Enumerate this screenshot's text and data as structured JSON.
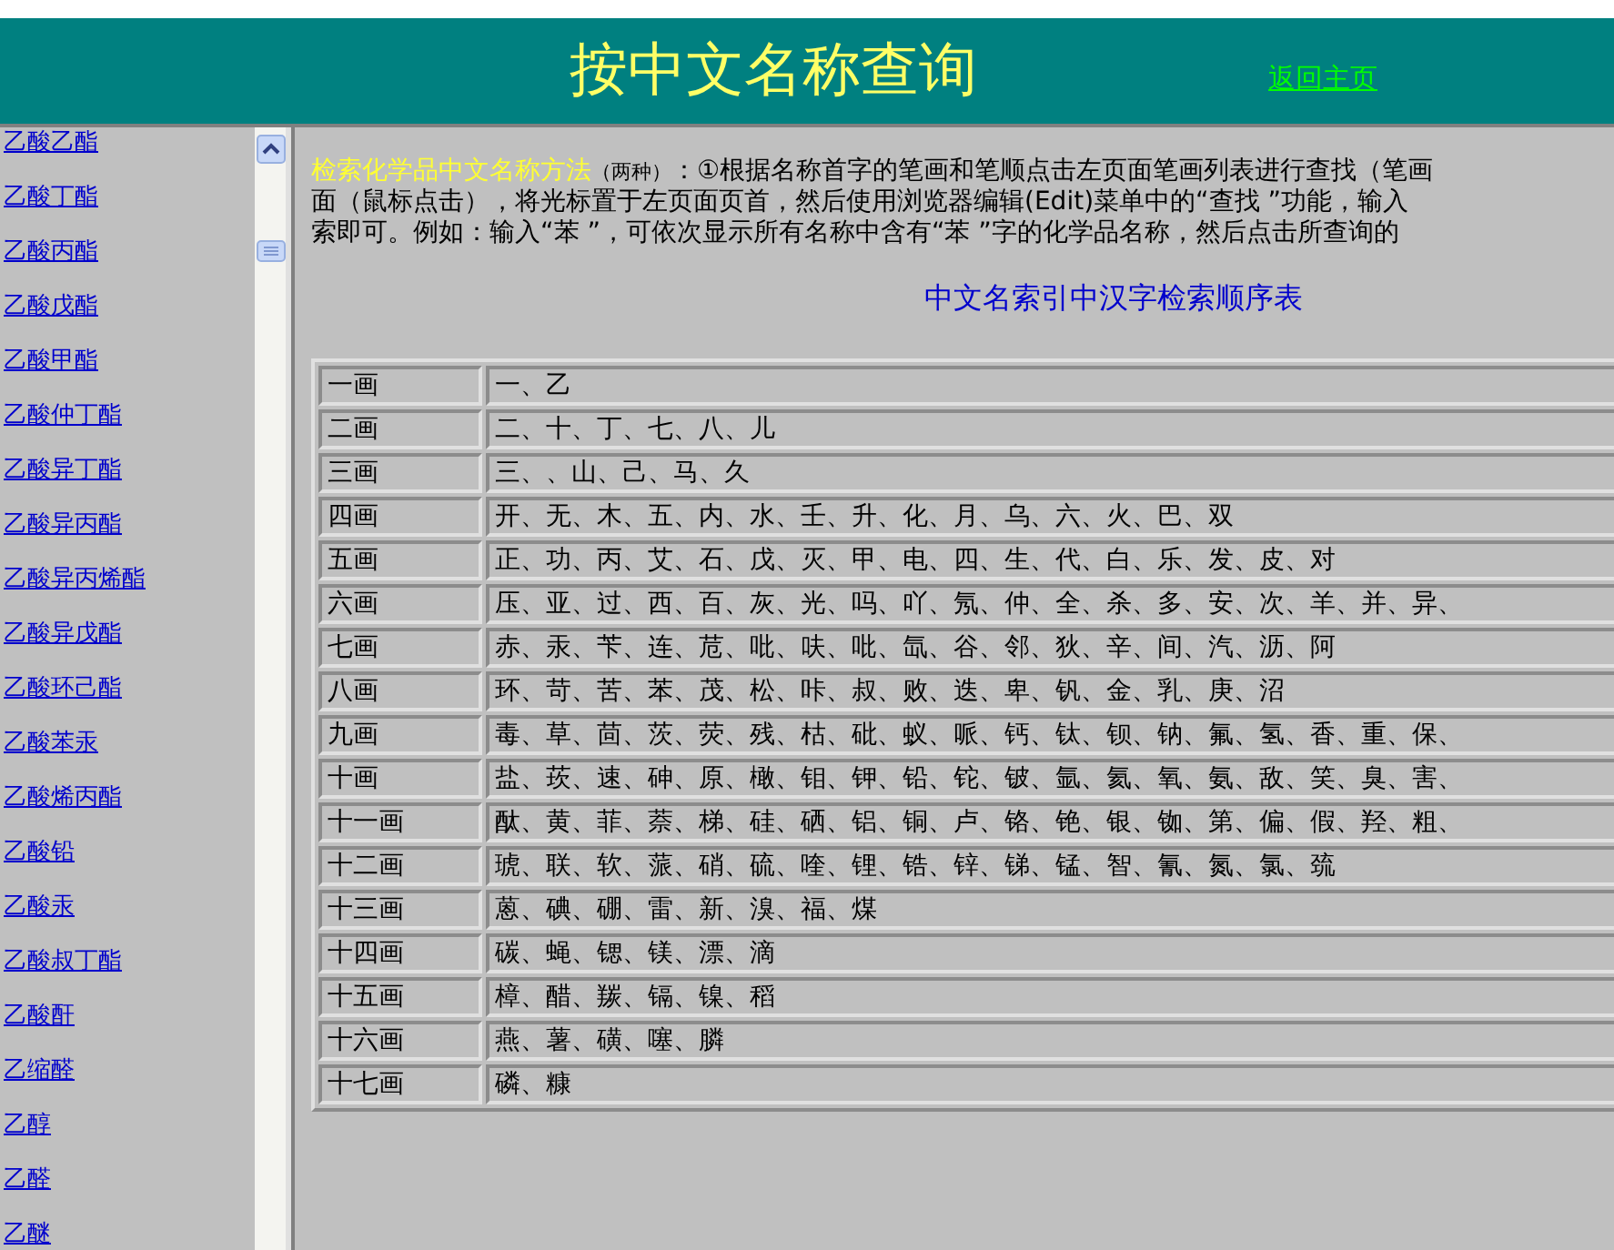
{
  "header": {
    "title": "按中文名称查询",
    "home_link": "返回主页"
  },
  "sidebar": {
    "items": [
      "乙酸乙酯",
      "乙酸丁酯",
      "乙酸丙酯",
      "乙酸戊酯",
      "乙酸甲酯",
      "乙酸仲丁酯",
      "乙酸异丁酯",
      "乙酸异丙酯",
      "乙酸异丙烯酯",
      "乙酸异戊酯",
      "乙酸环己酯",
      "乙酸苯汞",
      "乙酸烯丙酯",
      "乙酸铅",
      "乙酸汞",
      "乙酸叔丁酯",
      "乙酸酐",
      "乙缩醛",
      "乙醇",
      "乙醛",
      "乙醚"
    ]
  },
  "intro": {
    "heading": "检索化学品中文名称方法",
    "note": "（两种）",
    "lines": [
      "：①根据名称首字的笔画和笔顺点击左页面笔画列表进行查找（笔画",
      "面（鼠标点击），将光标置于左页面页首，然后使用浏览器编辑(Edit)菜单中的“查找 ”功能，输入",
      "索即可。例如：输入“苯 ”，可依次显示所有名称中含有“苯 ”字的化学品名称，然后点击所查询的"
    ]
  },
  "table": {
    "title": "中文名索引中汉字检索顺序表",
    "rows": [
      {
        "strokes": "一画",
        "chars": "一、乙"
      },
      {
        "strokes": "二画",
        "chars": "二、十、丁、七、八、儿"
      },
      {
        "strokes": "三画",
        "chars": "三、、山、己、马、久"
      },
      {
        "strokes": "四画",
        "chars": "开、无、木、五、内、水、壬、升、化、月、乌、六、火、巴、双"
      },
      {
        "strokes": "五画",
        "chars": "正、功、丙、艾、石、戊、灭、甲、电、四、生、代、白、乐、发、皮、对"
      },
      {
        "strokes": "六画",
        "chars": "压、亚、过、西、百、灰、光、吗、吖、氖、仲、全、杀、多、安、次、羊、并、异、"
      },
      {
        "strokes": "七画",
        "chars": "赤、汞、苄、连、苊、吡、呋、吡、氙、谷、邻、狄、辛、间、汽、沥、阿"
      },
      {
        "strokes": "八画",
        "chars": "环、苛、苦、苯、茂、松、咔、叔、败、迭、卑、钒、金、乳、庚、沼"
      },
      {
        "strokes": "九画",
        "chars": "毒、草、茴、茨、荧、残、枯、砒、蚁、哌、钙、钛、钡、钠、氟、氢、香、重、保、"
      },
      {
        "strokes": "十画",
        "chars": "盐、莰、速、砷、原、橄、钼、钾、铅、铊、铍、氩、氦、氧、氨、敌、笑、臭、害、"
      },
      {
        "strokes": "十一画",
        "chars": "酞、黄、菲、萘、梯、硅、硒、铝、铜、卢、铬、铯、银、铷、第、偏、假、羟、粗、"
      },
      {
        "strokes": "十二画",
        "chars": "琥、联、软、蒎、硝、硫、喹、锂、锆、锌、锑、锰、智、氰、氮、氯、巯"
      },
      {
        "strokes": "十三画",
        "chars": "蒽、碘、硼、雷、新、溴、福、煤"
      },
      {
        "strokes": "十四画",
        "chars": "碳、蝇、锶、镁、漂、滴"
      },
      {
        "strokes": "十五画",
        "chars": "樟、醋、羰、镉、镍、稻"
      },
      {
        "strokes": "十六画",
        "chars": "燕、薯、磺、噻、膦"
      },
      {
        "strokes": "十七画",
        "chars": "磷、糠"
      }
    ]
  }
}
